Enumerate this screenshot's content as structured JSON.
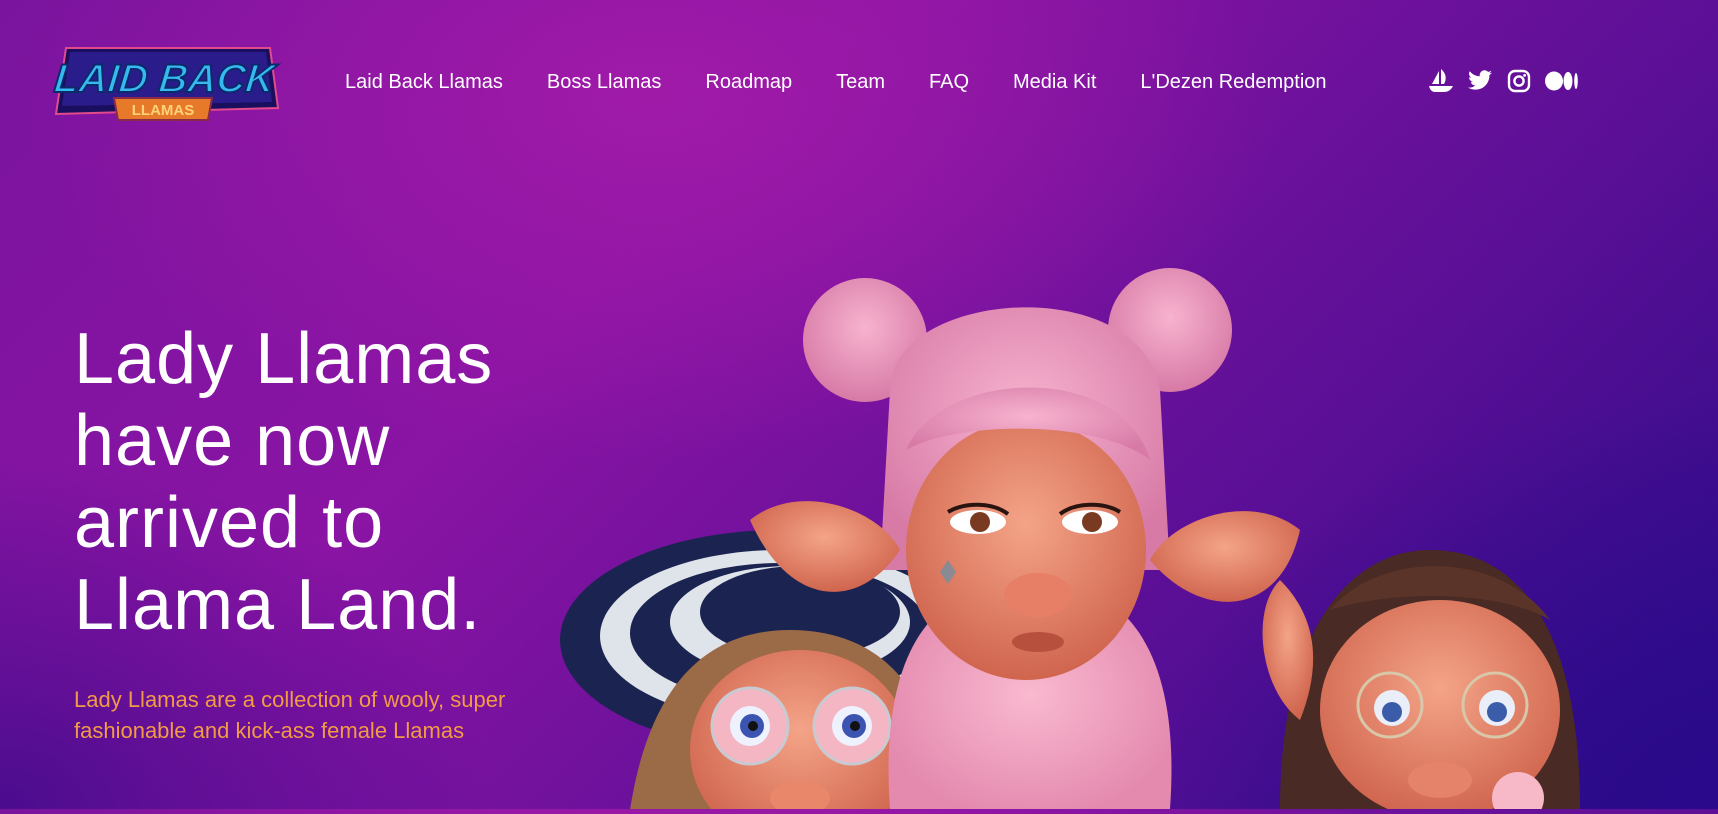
{
  "logo": {
    "line1": "LAID BACK",
    "line2": "LLAMAS"
  },
  "nav": {
    "items": [
      {
        "label": "Laid Back Llamas"
      },
      {
        "label": "Boss Llamas"
      },
      {
        "label": "Roadmap"
      },
      {
        "label": "Team"
      },
      {
        "label": "FAQ"
      },
      {
        "label": "Media Kit"
      },
      {
        "label": "L'Dezen Redemption"
      }
    ]
  },
  "social": [
    "opensea-icon",
    "twitter-icon",
    "instagram-icon",
    "medium-icon"
  ],
  "hero": {
    "title_lines": [
      "Lady Llamas",
      "have now",
      "arrived to",
      "Llama Land."
    ],
    "subtitle": "Lady Llamas are a collection of wooly, super fashionable and kick-ass female Llamas"
  },
  "colors": {
    "accent_text": "#f29a45",
    "background_top": "#9a18a6",
    "background_bottom": "#2a0c88"
  }
}
